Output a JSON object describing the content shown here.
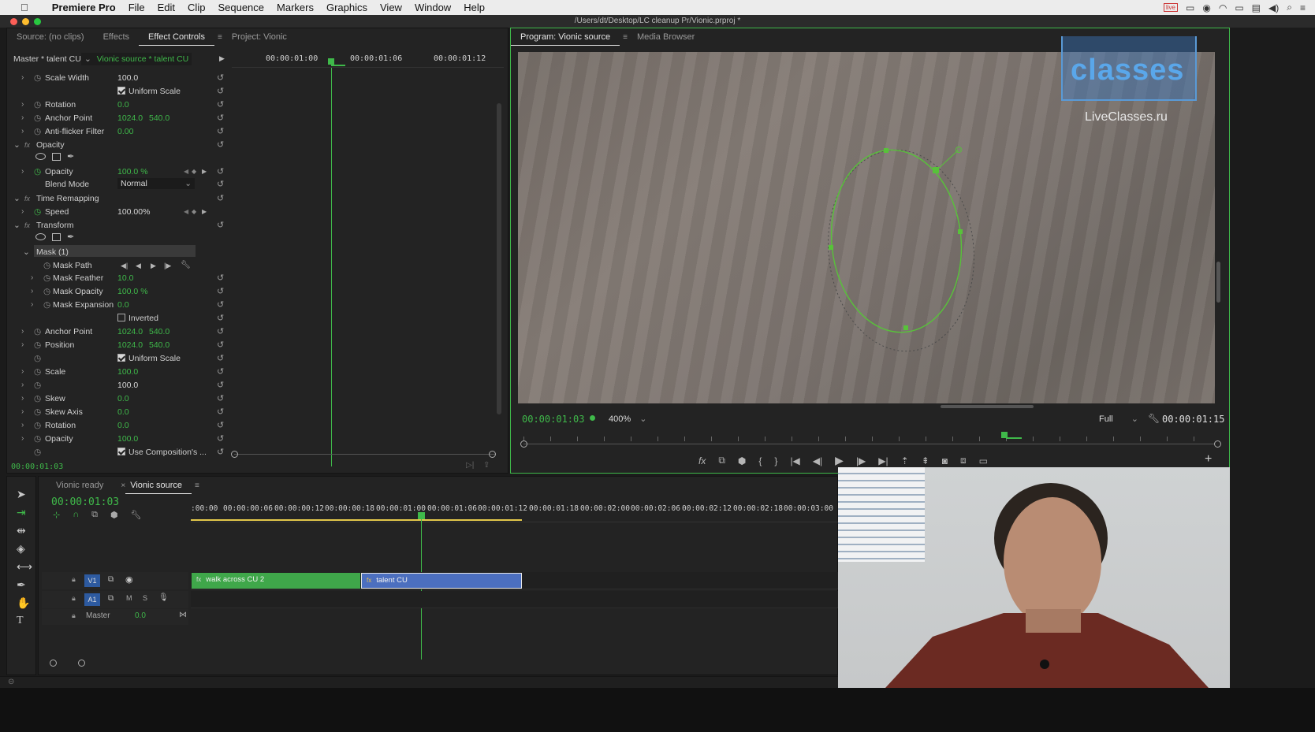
{
  "menubar": {
    "apple": "",
    "app_name": "Premiere Pro",
    "items": [
      "File",
      "Edit",
      "Clip",
      "Sequence",
      "Markers",
      "Graphics",
      "View",
      "Window",
      "Help"
    ]
  },
  "window": {
    "title": "/Users/dt/Desktop/LC cleanup Pr/Vionic.prproj *"
  },
  "left_panel": {
    "tabs": [
      "Source: (no clips)",
      "Effects",
      "Effect Controls",
      "Project: Vionic"
    ],
    "active_tab": "Effect Controls",
    "master_label": "Master * talent CU",
    "clip_selector": "Vionic source * talent CU",
    "ruler": [
      "00:00:01:00",
      "00:00:01:06",
      "00:00:01:12"
    ],
    "timecode": "00:00:01:03",
    "rows": [
      {
        "label": "Scale Width",
        "v1": "100.0",
        "v2": "",
        "kind": "prop"
      },
      {
        "label": "Uniform Scale",
        "kind": "check",
        "checked": true
      },
      {
        "label": "Rotation",
        "v1": "0.0",
        "kind": "prop"
      },
      {
        "label": "Anchor Point",
        "v1": "1024.0",
        "v2": "540.0",
        "kind": "prop"
      },
      {
        "label": "Anti-flicker Filter",
        "v1": "0.00",
        "kind": "prop"
      },
      {
        "label": "Opacity",
        "kind": "section"
      },
      {
        "label": "Opacity",
        "v1": "100.0 %",
        "kind": "prop"
      },
      {
        "label": "Blend Mode",
        "v1": "Normal",
        "kind": "select"
      },
      {
        "label": "Time Remapping",
        "kind": "section"
      },
      {
        "label": "Speed",
        "v1": "100.00%",
        "kind": "prop"
      },
      {
        "label": "Transform",
        "kind": "section"
      },
      {
        "label": "Mask (1)",
        "kind": "mask"
      },
      {
        "label": "Mask Path",
        "kind": "maskpath"
      },
      {
        "label": "Mask Feather",
        "v1": "10.0",
        "kind": "prop"
      },
      {
        "label": "Mask Opacity",
        "v1": "100.0 %",
        "kind": "prop"
      },
      {
        "label": "Mask Expansion",
        "v1": "0.0",
        "kind": "prop"
      },
      {
        "label": "Inverted",
        "kind": "check",
        "checked": false
      },
      {
        "label": "Anchor Point",
        "v1": "1024.0",
        "v2": "540.0",
        "kind": "prop"
      },
      {
        "label": "Position",
        "v1": "1024.0",
        "v2": "540.0",
        "kind": "prop"
      },
      {
        "label": "Uniform Scale",
        "kind": "check",
        "checked": true
      },
      {
        "label": "Scale",
        "v1": "100.0",
        "kind": "prop"
      },
      {
        "label": "",
        "v1": "100.0",
        "kind": "propw"
      },
      {
        "label": "Skew",
        "v1": "0.0",
        "kind": "prop"
      },
      {
        "label": "Skew Axis",
        "v1": "0.0",
        "kind": "prop"
      },
      {
        "label": "Rotation",
        "v1": "0.0",
        "kind": "prop"
      },
      {
        "label": "Opacity",
        "v1": "100.0",
        "kind": "prop"
      },
      {
        "label": "Use Composition's ...",
        "kind": "check",
        "checked": true
      }
    ]
  },
  "program": {
    "tabs": [
      "Program: Vionic source",
      "Media Browser"
    ],
    "timecode": "00:00:01:03",
    "zoom": "400%",
    "quality": "Full",
    "duration": "00:00:01:15",
    "watermark_brand": "classes",
    "watermark_url": "LiveClasses.ru"
  },
  "timeline": {
    "tabs": [
      "Vionic ready",
      "Vionic source"
    ],
    "timecode": "00:00:01:03",
    "ruler": [
      ":00:00",
      "00:00:00:06",
      "00:00:00:12",
      "00:00:00:18",
      "00:00:01:00",
      "00:00:01:06",
      "00:00:01:12",
      "00:00:01:18",
      "00:00:02:00",
      "00:00:02:06",
      "00:00:02:12",
      "00:00:02:18",
      "00:00:03:00"
    ],
    "tracks": {
      "v1": "V1",
      "a1": "A1",
      "master": "Master",
      "master_val": "0.0",
      "m": "M",
      "s": "S"
    },
    "clips": [
      "walk across CU 2",
      "talent CU"
    ]
  },
  "colors": {
    "accent": "#3fb94a",
    "clip_green": "#3fa74a",
    "clip_blue": "#4c6fbf"
  }
}
